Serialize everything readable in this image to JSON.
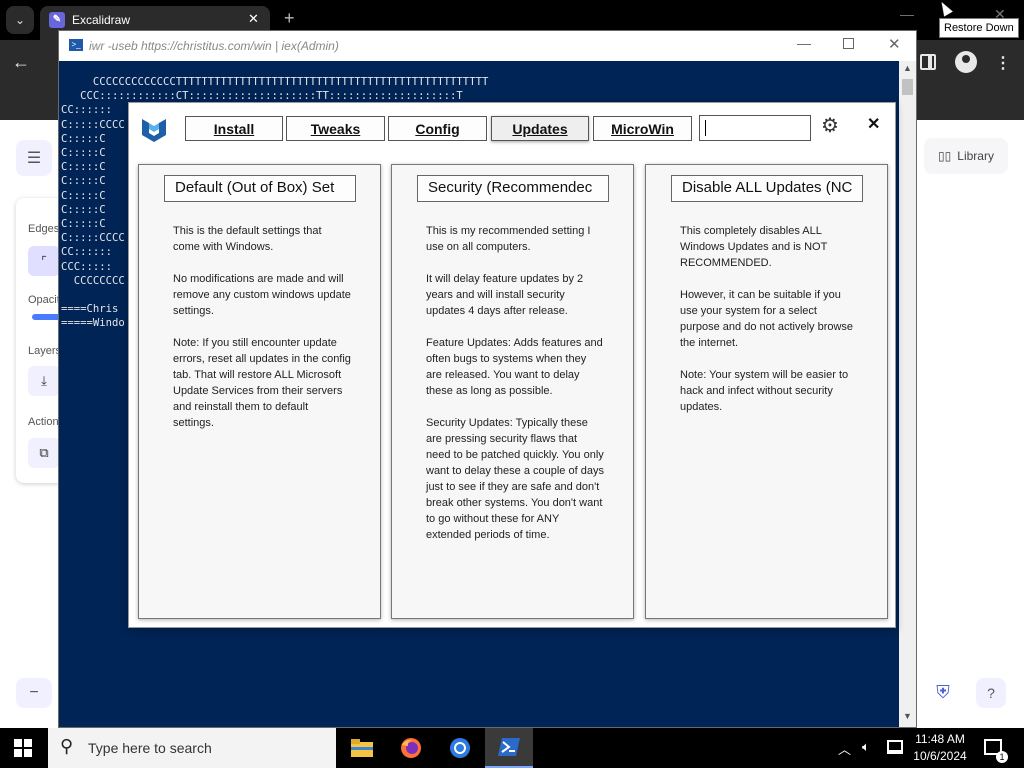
{
  "browser": {
    "tab_title": "Excalidraw",
    "tab_favicon_glyph": "✎",
    "new_tab_glyph": "+",
    "tooltip": "Restore Down"
  },
  "excalidraw": {
    "library_label": "Library",
    "edges_label": "Edges",
    "opacity_label": "Opacit",
    "layers_label": "Layers",
    "actions_label": "Action",
    "opacity_value": 1.0,
    "accent_color": "#6965db"
  },
  "powershell": {
    "title": "iwr -useb https://christitus.com/win | iex(Admin)",
    "background_color": "#012456",
    "console_lines": [
      "     CCCCCCCCCCCCCTTTTTTTTTTTTTTTTTTTTTTTTTTTTTTTTTTTTTTTTTTTTTTTTT",
      "   CCC::::::::::::CT::::::::::::::::::::TT::::::::::::::::::::T",
      "CC::::::",
      "C:::::CCCC",
      "C:::::C",
      "C:::::C",
      "C:::::C",
      "C:::::C",
      "C:::::C",
      "C:::::C",
      "C:::::C",
      "C:::::CCCC",
      "CC::::::",
      "CCC:::::",
      "  CCCCCCCC",
      "",
      "====Chris",
      "=====Windo"
    ]
  },
  "winutil": {
    "nav": [
      {
        "label": "Install"
      },
      {
        "label": "Tweaks"
      },
      {
        "label": "Config"
      },
      {
        "label": "Updates",
        "active": true
      },
      {
        "label": "MicroWin"
      }
    ],
    "search_value": "",
    "cards": [
      {
        "button": "Default (Out of Box) Set",
        "text": "This is the default settings that come with Windows.\n\nNo modifications are made and will remove any custom windows update settings.\n\nNote: If you still encounter update errors, reset all updates in the config tab. That will restore ALL Microsoft Update Services from their servers and reinstall them to default settings."
      },
      {
        "button": "Security (Recommendec",
        "text": "This is my recommended setting I use on all computers.\n\nIt will delay feature updates by 2 years and will install security updates 4 days after release.\n\nFeature Updates: Adds features and often bugs to systems when they are released. You want to delay these as long as possible.\n\nSecurity Updates: Typically these are pressing security flaws that need to be patched quickly. You only want to delay these a couple of days just to see if they are safe and don't break other systems. You don't want to go without these for ANY extended periods of time."
      },
      {
        "button": "Disable ALL Updates (NC",
        "text": "This completely disables ALL Windows Updates and is NOT RECOMMENDED.\n\nHowever, it can be suitable if you use your system for a select purpose and do not actively browse the internet.\n\nNote: Your system will be easier to hack and infect without security updates."
      }
    ]
  },
  "taskbar": {
    "search_placeholder": "Type here to search",
    "time": "11:48 AM",
    "date": "10/6/2024",
    "notification_count": "1",
    "apps": [
      "file-explorer",
      "firefox",
      "chromium",
      "powershell"
    ]
  }
}
